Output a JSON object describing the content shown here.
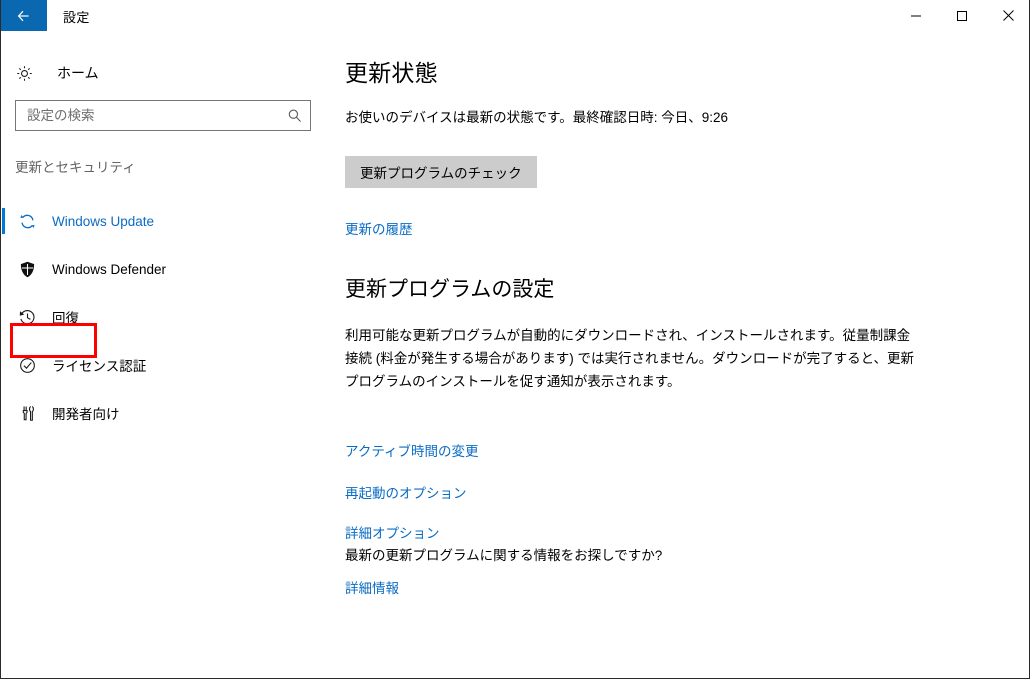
{
  "window": {
    "title": "設定",
    "back_button": "戻る",
    "minimize_label": "最小化",
    "maximize_label": "最大化",
    "close_label": "閉じる",
    "accent_color": "#0078d7",
    "back_button_color": "#0a68b0",
    "link_color": "#0a6cc4",
    "highlight_color": "#ff0000"
  },
  "sidebar": {
    "home_label": "ホーム",
    "search": {
      "placeholder": "設定の検索",
      "value": ""
    },
    "section_header": "更新とセキュリティ",
    "items": [
      {
        "label": "Windows Update",
        "icon": "sync-icon",
        "selected": true
      },
      {
        "label": "Windows Defender",
        "icon": "shield-icon",
        "selected": false
      },
      {
        "label": "回復",
        "icon": "clock-history-icon",
        "selected": false,
        "highlighted": true
      },
      {
        "label": "ライセンス認証",
        "icon": "check-circle-icon",
        "selected": false
      },
      {
        "label": "開発者向け",
        "icon": "developer-tools-icon",
        "selected": false
      }
    ]
  },
  "main": {
    "heading": "更新状態",
    "status_text": "お使いのデバイスは最新の状態です。最終確認日時: 今日、9:26",
    "check_button_label": "更新プログラムのチェック",
    "history_link": "更新の履歴",
    "settings_heading": "更新プログラムの設定",
    "settings_paragraph": "利用可能な更新プログラムが自動的にダウンロードされ、インストールされます。従量制課金接続 (料金が発生する場合があります) では実行されません。ダウンロードが完了すると、更新プログラムのインストールを促す通知が表示されます。",
    "links": {
      "active_hours": "アクティブ時間の変更",
      "restart_options": "再起動のオプション",
      "advanced_options": "詳細オプション",
      "more_info": "詳細情報"
    },
    "question_text": "最新の更新プログラムに関する情報をお探しですか?"
  }
}
